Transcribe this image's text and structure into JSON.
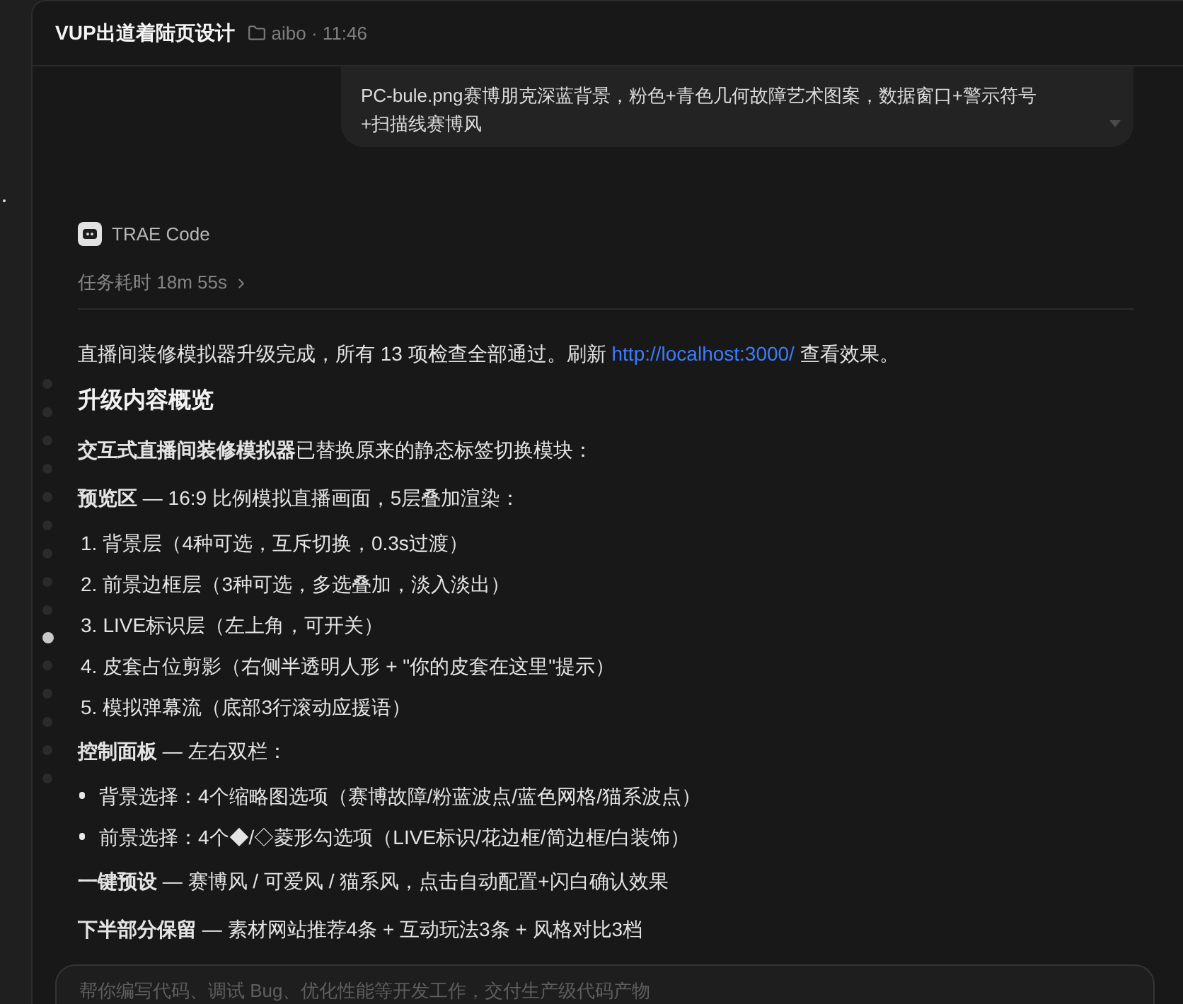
{
  "header": {
    "title": "VUP出道着陆页设计",
    "meta": "aibo · 11:46"
  },
  "user_message": {
    "text": "PC-bule.png赛博朋克深蓝背景，粉色+青色几何故障艺术图案，数据窗口+警示符号+扫描线赛博风"
  },
  "assistant": {
    "name": "TRAE Code",
    "duration": "任务耗时 18m 55s",
    "blocks": [
      {
        "kind": "paragraph",
        "text": "直播间装修模拟器升级完成，所有 13 项检查全部通过。刷新 ",
        "link": "http://localhost:3000/",
        "after": " 查看效果。"
      },
      {
        "kind": "heading",
        "text": "升级内容概览"
      },
      {
        "kind": "paragraph",
        "text": "**交互式直播间装修模拟器**已替换原来的静态标签切换模块："
      },
      {
        "kind": "paragraph",
        "text": "**预览区** — 16:9 比例模拟直播画面，5层叠加渲染："
      },
      {
        "kind": "ordered_item",
        "number": "1.",
        "text": "背景层（4种可选，互斥切换，0.3s过渡）"
      },
      {
        "kind": "ordered_item",
        "number": "2.",
        "text": "前景边框层（3种可选，多选叠加，淡入淡出）"
      },
      {
        "kind": "ordered_item",
        "number": "3.",
        "text": "LIVE标识层（左上角，可开关）"
      },
      {
        "kind": "ordered_item",
        "number": "4.",
        "text": "皮套占位剪影（右侧半透明人形 + \"你的皮套在这里\"提示）"
      },
      {
        "kind": "ordered_item",
        "number": "5.",
        "text": "模拟弹幕流（底部3行滚动应援语）"
      },
      {
        "kind": "paragraph",
        "text": "**控制面板** — 左右双栏："
      },
      {
        "kind": "bullet_item",
        "text": "背景选择：4个缩略图选项（赛博故障/粉蓝波点/蓝色网格/猫系波点）"
      },
      {
        "kind": "bullet_item",
        "text": "前景选择：4个◆/◇菱形勾选项（LIVE标识/花边框/简边框/白装饰）"
      },
      {
        "kind": "paragraph",
        "text": "**一键预设** — 赛博风 / 可爱风 / 猫系风，点击自动配置+闪白确认效果"
      },
      {
        "kind": "paragraph",
        "text": "**下半部分保留** — 素材网站推荐4条 + 互动玩法3条 + 风格对比3档"
      }
    ]
  },
  "nav_dots": [
    {
      "selected": false
    },
    {
      "selected": false
    },
    {
      "selected": false
    },
    {
      "selected": false
    },
    {
      "selected": false
    },
    {
      "selected": false
    },
    {
      "selected": false
    },
    {
      "selected": false
    },
    {
      "selected": false
    },
    {
      "selected": true
    },
    {
      "selected": false
    },
    {
      "selected": false
    },
    {
      "selected": false
    },
    {
      "selected": false
    },
    {
      "selected": false
    }
  ],
  "composer": {
    "placeholder": "帮你编写代码、调试 Bug、优化性能等开发工作，交付生产级代码产物"
  }
}
